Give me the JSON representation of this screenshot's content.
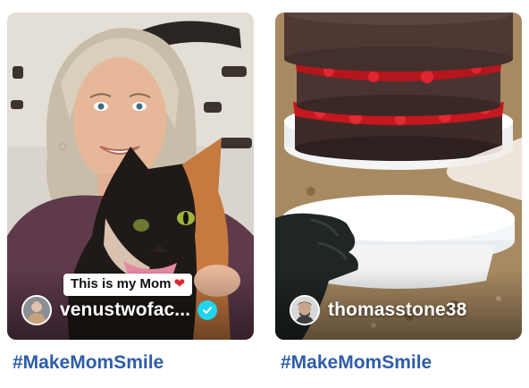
{
  "cards": [
    {
      "caption_sticker": "This is my Mom",
      "heart_glyph": "❤",
      "creator": "venustwofac...",
      "verified": true,
      "avatar_icon": "user-avatar-photo",
      "hashtag": "#MakeMomSmile"
    },
    {
      "creator": "thomasstone38",
      "verified": false,
      "avatar_icon": "user-avatar-photo",
      "hashtag": "#MakeMomSmile"
    }
  ],
  "colors": {
    "hashtag": "#2f5da8",
    "verified_badge": "#20d5ec",
    "caption_heart": "#e0242f"
  }
}
